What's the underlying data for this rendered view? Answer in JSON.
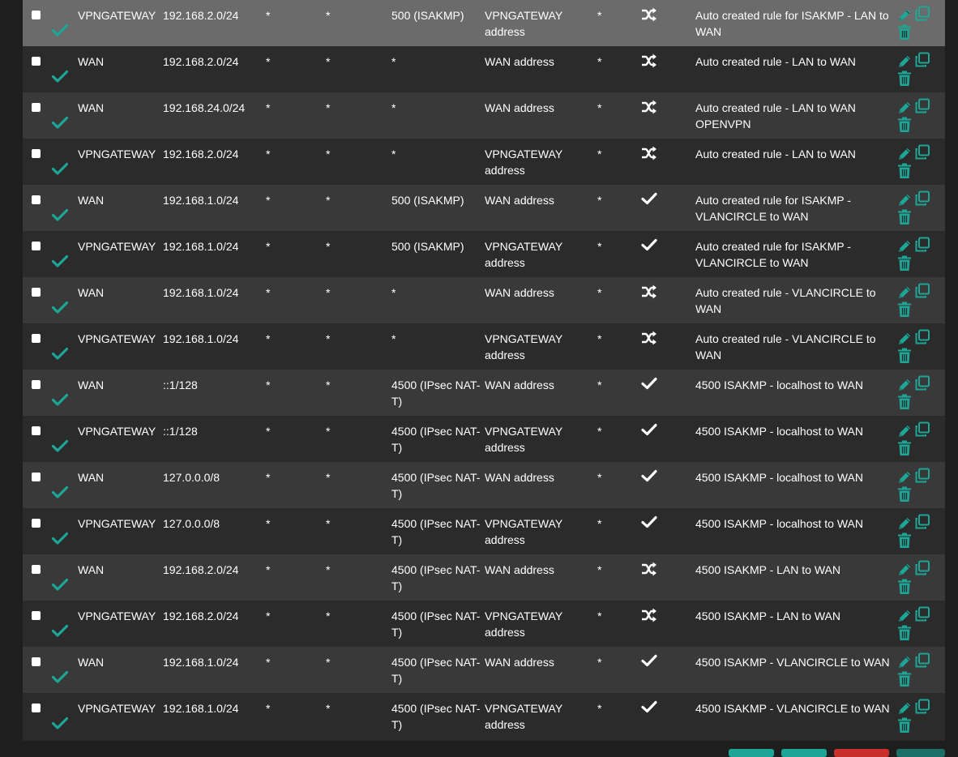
{
  "colors": {
    "accent": "#1da596",
    "danger": "#c9302c",
    "white": "#ffffff"
  },
  "icons": {
    "status": "checkmark-icon",
    "translation_static": "shuffle-icon",
    "translation_nonat": "check-icon",
    "edit": "pencil-icon",
    "copy": "copy-icon",
    "delete": "trash-icon"
  },
  "rules": [
    {
      "interface": "VPNGATEWAY",
      "source": "192.168.2.0/24",
      "source_port": "*",
      "destination": "*",
      "destination_port": "500 (ISAKMP)",
      "nat_address": "VPNGATEWAY address",
      "nat_port": "*",
      "static_port": "shuffle",
      "description": "Auto created rule for ISAKMP - LAN to WAN",
      "selected": true
    },
    {
      "interface": "WAN",
      "source": "192.168.2.0/24",
      "source_port": "*",
      "destination": "*",
      "destination_port": "*",
      "nat_address": "WAN address",
      "nat_port": "*",
      "static_port": "shuffle",
      "description": "Auto created rule - LAN to WAN",
      "selected": false
    },
    {
      "interface": "WAN",
      "source": "192.168.24.0/24",
      "source_port": "*",
      "destination": "*",
      "destination_port": "*",
      "nat_address": "WAN address",
      "nat_port": "*",
      "static_port": "shuffle",
      "description": "Auto created rule - LAN to WAN OPENVPN",
      "selected": false
    },
    {
      "interface": "VPNGATEWAY",
      "source": "192.168.2.0/24",
      "source_port": "*",
      "destination": "*",
      "destination_port": "*",
      "nat_address": "VPNGATEWAY address",
      "nat_port": "*",
      "static_port": "shuffle",
      "description": "Auto created rule - LAN to WAN",
      "selected": false
    },
    {
      "interface": "WAN",
      "source": "192.168.1.0/24",
      "source_port": "*",
      "destination": "*",
      "destination_port": "500 (ISAKMP)",
      "nat_address": "WAN address",
      "nat_port": "*",
      "static_port": "check",
      "description": "Auto created rule for ISAKMP - VLANCIRCLE to WAN",
      "selected": false
    },
    {
      "interface": "VPNGATEWAY",
      "source": "192.168.1.0/24",
      "source_port": "*",
      "destination": "*",
      "destination_port": "500 (ISAKMP)",
      "nat_address": "VPNGATEWAY address",
      "nat_port": "*",
      "static_port": "check",
      "description": "Auto created rule for ISAKMP - VLANCIRCLE to WAN",
      "selected": false
    },
    {
      "interface": "WAN",
      "source": "192.168.1.0/24",
      "source_port": "*",
      "destination": "*",
      "destination_port": "*",
      "nat_address": "WAN address",
      "nat_port": "*",
      "static_port": "shuffle",
      "description": "Auto created rule - VLANCIRCLE to WAN",
      "selected": false
    },
    {
      "interface": "VPNGATEWAY",
      "source": "192.168.1.0/24",
      "source_port": "*",
      "destination": "*",
      "destination_port": "*",
      "nat_address": "VPNGATEWAY address",
      "nat_port": "*",
      "static_port": "shuffle",
      "description": "Auto created rule - VLANCIRCLE to WAN",
      "selected": false
    },
    {
      "interface": "WAN",
      "source": "::1/128",
      "source_port": "*",
      "destination": "*",
      "destination_port": "4500 (IPsec NAT-T)",
      "nat_address": "WAN address",
      "nat_port": "*",
      "static_port": "check",
      "description": "4500 ISAKMP - localhost to WAN",
      "selected": false
    },
    {
      "interface": "VPNGATEWAY",
      "source": "::1/128",
      "source_port": "*",
      "destination": "*",
      "destination_port": "4500 (IPsec NAT-T)",
      "nat_address": "VPNGATEWAY address",
      "nat_port": "*",
      "static_port": "check",
      "description": "4500 ISAKMP - localhost to WAN",
      "selected": false
    },
    {
      "interface": "WAN",
      "source": "127.0.0.0/8",
      "source_port": "*",
      "destination": "*",
      "destination_port": "4500 (IPsec NAT-T)",
      "nat_address": "WAN address",
      "nat_port": "*",
      "static_port": "check",
      "description": "4500 ISAKMP - localhost to WAN",
      "selected": false
    },
    {
      "interface": "VPNGATEWAY",
      "source": "127.0.0.0/8",
      "source_port": "*",
      "destination": "*",
      "destination_port": "4500 (IPsec NAT-T)",
      "nat_address": "VPNGATEWAY address",
      "nat_port": "*",
      "static_port": "check",
      "description": "4500 ISAKMP - localhost to WAN",
      "selected": false
    },
    {
      "interface": "WAN",
      "source": "192.168.2.0/24",
      "source_port": "*",
      "destination": "*",
      "destination_port": "4500 (IPsec NAT-T)",
      "nat_address": "WAN address",
      "nat_port": "*",
      "static_port": "shuffle",
      "description": "4500 ISAKMP - LAN to WAN",
      "selected": false
    },
    {
      "interface": "VPNGATEWAY",
      "source": "192.168.2.0/24",
      "source_port": "*",
      "destination": "*",
      "destination_port": "4500 (IPsec NAT-T)",
      "nat_address": "VPNGATEWAY address",
      "nat_port": "*",
      "static_port": "shuffle",
      "description": "4500 ISAKMP - LAN to WAN",
      "selected": false
    },
    {
      "interface": "WAN",
      "source": "192.168.1.0/24",
      "source_port": "*",
      "destination": "*",
      "destination_port": "4500 (IPsec NAT-T)",
      "nat_address": "WAN address",
      "nat_port": "*",
      "static_port": "check",
      "description": "4500 ISAKMP - VLANCIRCLE to WAN",
      "selected": false
    },
    {
      "interface": "VPNGATEWAY",
      "source": "192.168.1.0/24",
      "source_port": "*",
      "destination": "*",
      "destination_port": "4500 (IPsec NAT-T)",
      "nat_address": "VPNGATEWAY address",
      "nat_port": "*",
      "static_port": "check",
      "description": "4500 ISAKMP - VLANCIRCLE to WAN",
      "selected": false
    }
  ],
  "footer_buttons": [
    {
      "name": "footer-button-1",
      "color": "#1da596"
    },
    {
      "name": "footer-button-2",
      "color": "#1da596"
    },
    {
      "name": "footer-button-3",
      "color": "#c9302c"
    },
    {
      "name": "footer-button-4",
      "color": "#1a6f67"
    }
  ]
}
